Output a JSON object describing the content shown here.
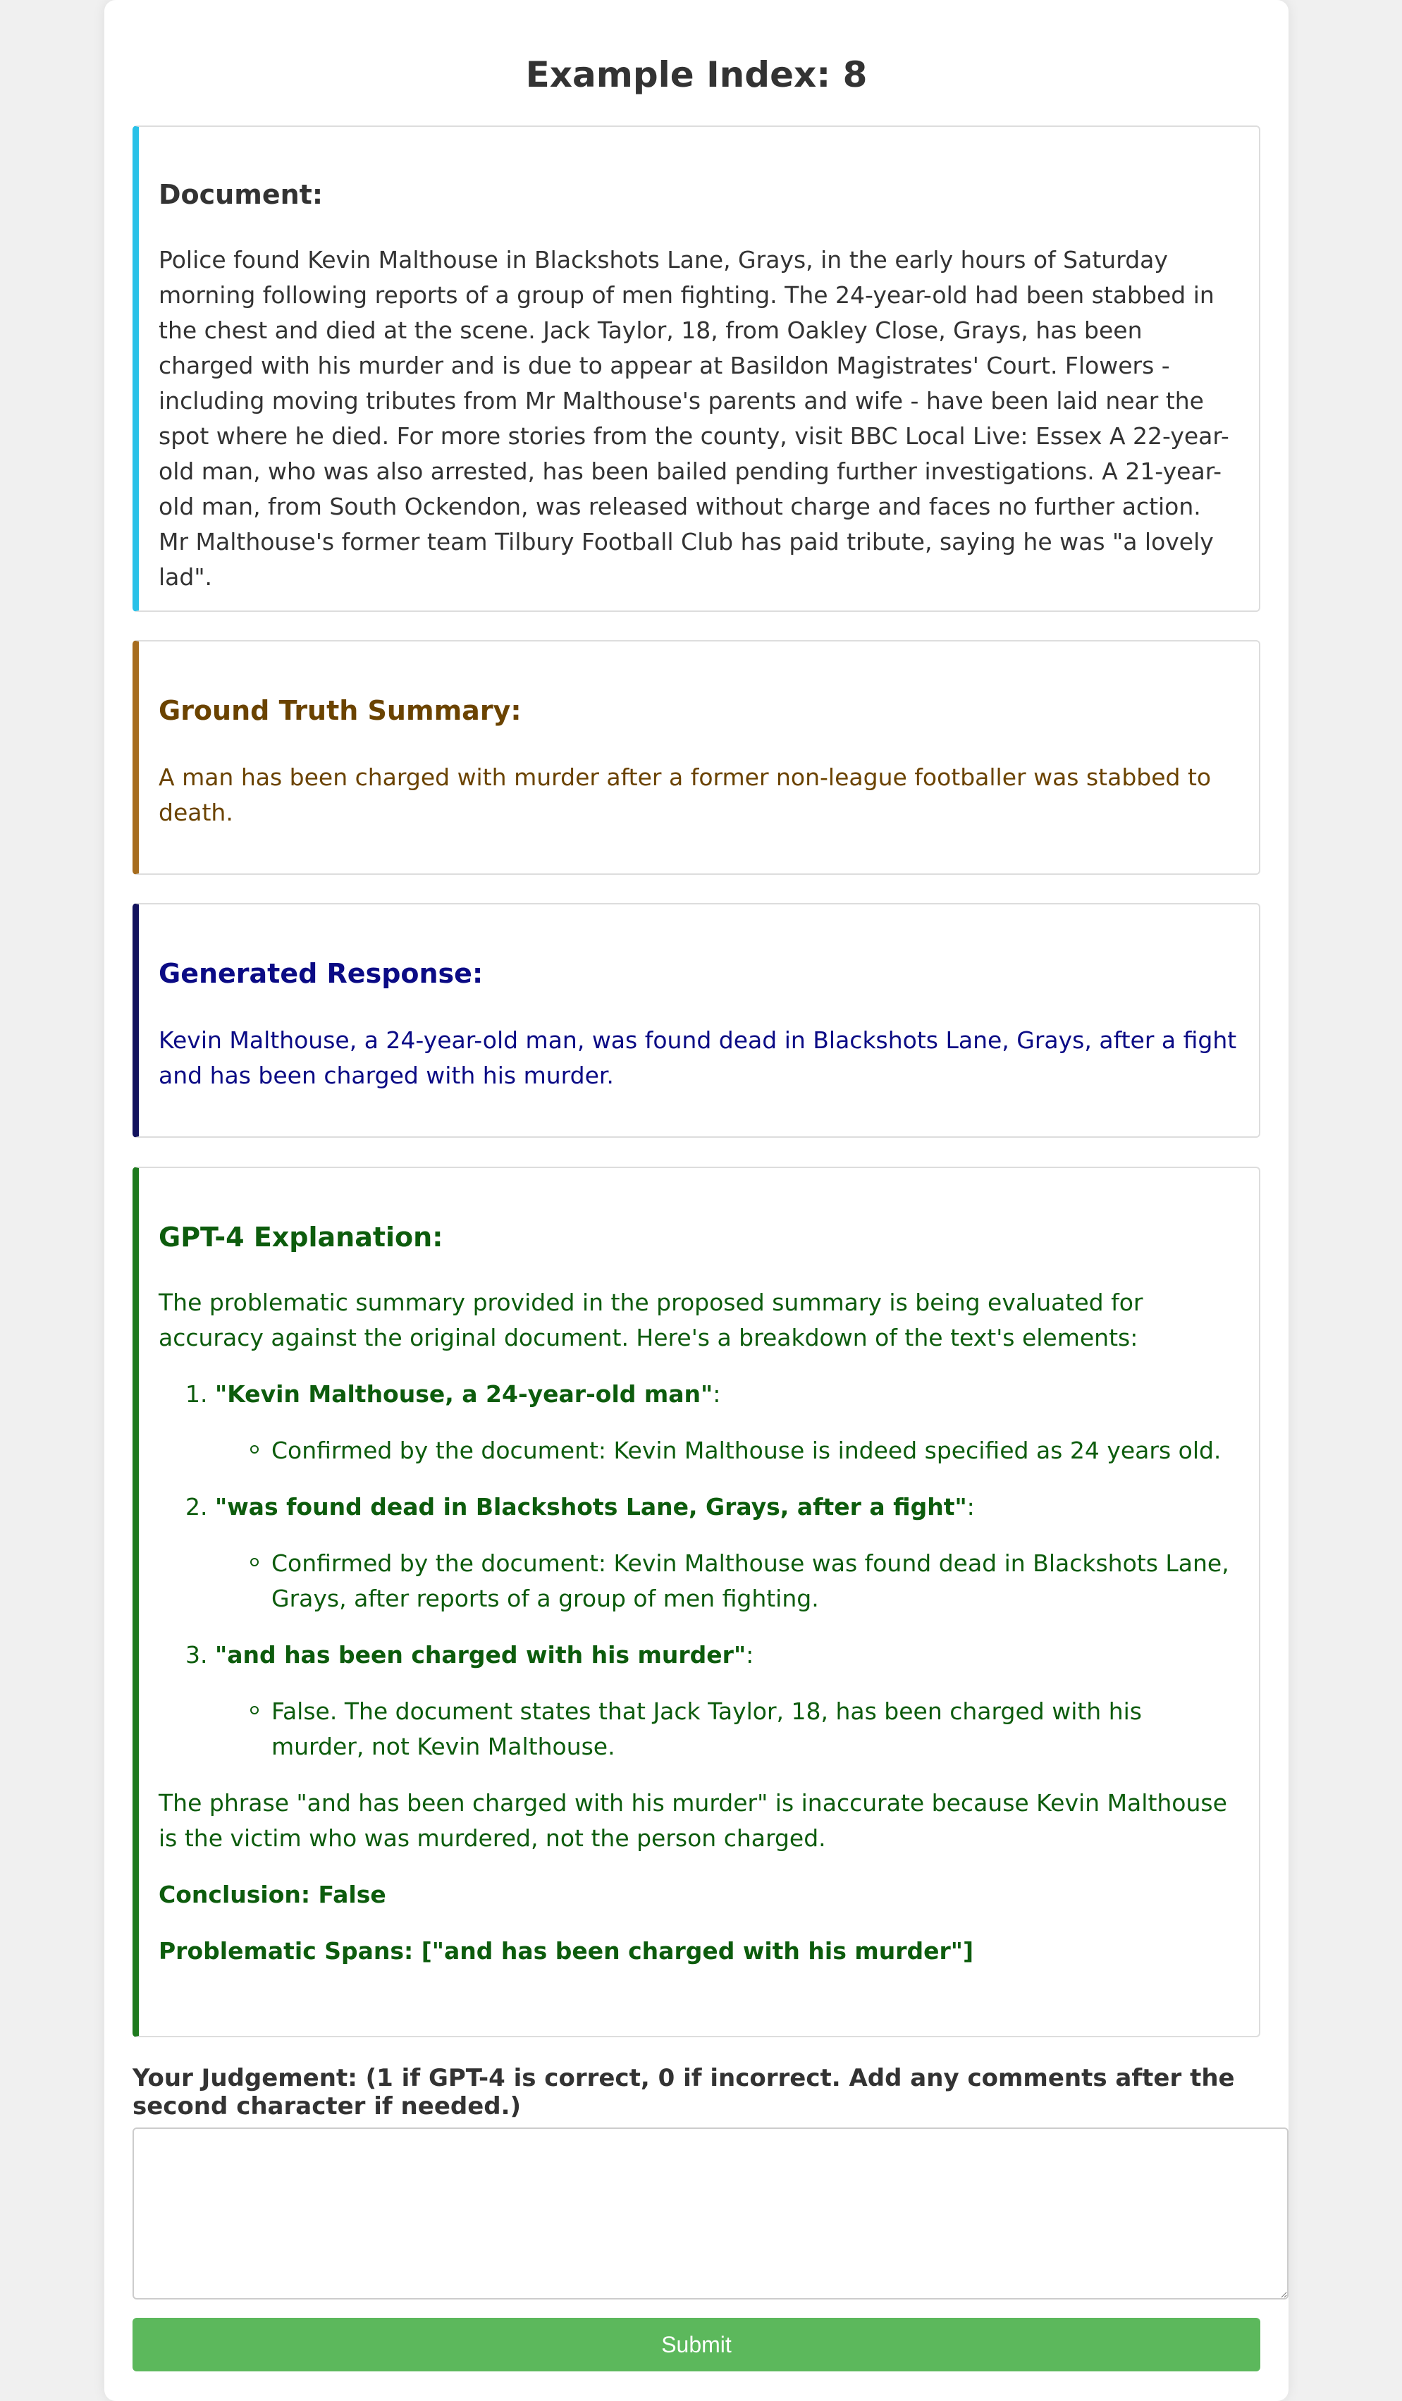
{
  "title": "Example Index: 8",
  "document": {
    "heading": "Document:",
    "text": "Police found Kevin Malthouse in Blackshots Lane, Grays, in the early hours of Saturday morning following reports of a group of men fighting. The 24-year-old had been stabbed in the chest and died at the scene. Jack Taylor, 18, from Oakley Close, Grays, has been charged with his murder and is due to appear at Basildon Magistrates' Court. Flowers - including moving tributes from Mr Malthouse's parents and wife - have been laid near the spot where he died. For more stories from the county, visit BBC Local Live: Essex A 22-year-old man, who was also arrested, has been bailed pending further investigations. A 21-year-old man, from South Ockendon, was released without charge and faces no further action. Mr Malthouse's former team Tilbury Football Club has paid tribute, saying he was \"a lovely lad\"."
  },
  "ground_truth": {
    "heading": "Ground Truth Summary:",
    "text": "A man has been charged with murder after a former non-league footballer was stabbed to death."
  },
  "generated": {
    "heading": "Generated Response:",
    "text": "Kevin Malthouse, a 24-year-old man, was found dead in Blackshots Lane, Grays, after a fight and has been charged with his murder."
  },
  "gpt4": {
    "heading": "GPT-4 Explanation:",
    "intro": "The problematic summary provided in the proposed summary is being evaluated for accuracy against the original document. Here's a breakdown of the text's elements:",
    "items": [
      {
        "quote": "\"Kevin Malthouse, a 24-year-old man\"",
        "colon": ":",
        "detail": "Confirmed by the document: Kevin Malthouse is indeed specified as 24 years old."
      },
      {
        "quote": "\"was found dead in Blackshots Lane, Grays, after a fight\"",
        "colon": ":",
        "detail": "Confirmed by the document: Kevin Malthouse was found dead in Blackshots Lane, Grays, after reports of a group of men fighting."
      },
      {
        "quote": "\"and has been charged with his murder\"",
        "colon": ":",
        "detail": "False. The document states that Jack Taylor, 18, has been charged with his murder, not Kevin Malthouse."
      }
    ],
    "closing": "The phrase \"and has been charged with his murder\" is inaccurate because Kevin Malthouse is the victim who was murdered, not the person charged.",
    "conclusion": "Conclusion: False",
    "spans": "Problematic Spans: [\"and has been charged with his murder\"]"
  },
  "judgement": {
    "label": "Your Judgement: (1 if GPT-4 is correct, 0 if incorrect. Add any comments after the second character if needed.)",
    "value": ""
  },
  "submit_label": "Submit",
  "colors": {
    "document_accent": "#29c1e8",
    "truth_accent": "#a66c1e",
    "generated_accent": "#12125e",
    "gpt_accent": "#1e7a1e",
    "submit": "#5cb85c"
  }
}
